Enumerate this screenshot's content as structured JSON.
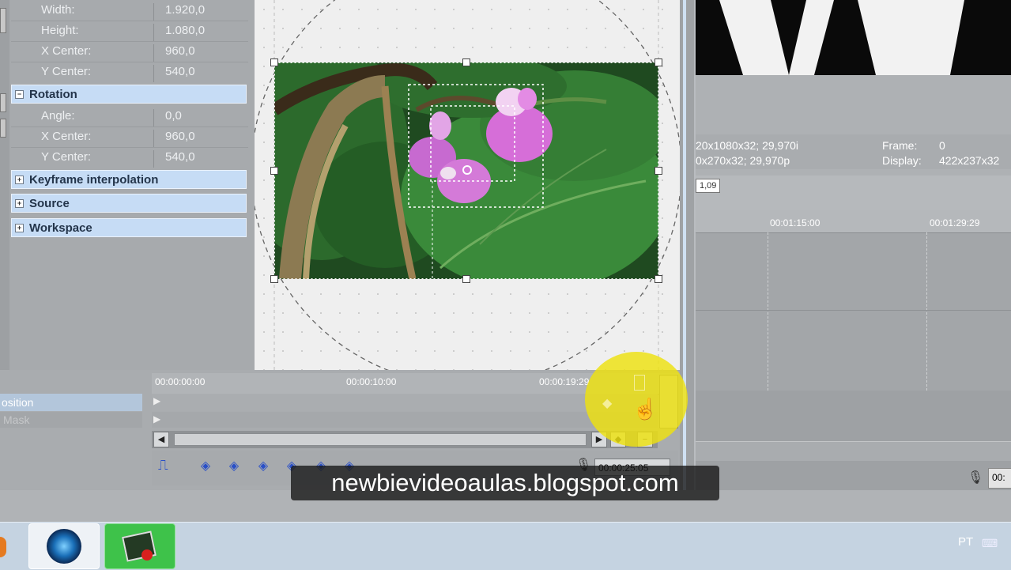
{
  "properties": {
    "rows_top": [
      {
        "label": "Width:",
        "value": "1.920,0"
      },
      {
        "label": "Height:",
        "value": "1.080,0"
      },
      {
        "label": "X Center:",
        "value": "960,0"
      },
      {
        "label": "Y Center:",
        "value": "540,0"
      }
    ],
    "rotation": {
      "title": "Rotation",
      "rows": [
        {
          "label": "Angle:",
          "value": "0,0"
        },
        {
          "label": "X Center:",
          "value": "960,0"
        },
        {
          "label": "Y Center:",
          "value": "540,0"
        }
      ]
    },
    "sections": [
      "Keyframe interpolation",
      "Source",
      "Workspace"
    ]
  },
  "preview": {
    "frame_info": "20x1080x32; 29,970i",
    "display_info": "0x270x32; 29,970p",
    "frame_label": "Frame:",
    "frame_value": "0",
    "display_label": "Display:",
    "display_value": "422x237x32",
    "badge": "1,09"
  },
  "main_timeline": {
    "ticks": [
      "00:01:15:00",
      "00:01:29:29"
    ]
  },
  "keyframes": {
    "ruler": [
      "00:00:00:00",
      "00:00:10:00",
      "00:00:19:29"
    ],
    "tracks": [
      "osition",
      "Mask"
    ],
    "cursor_time": "00:00:25:05"
  },
  "watermark": "newbievideoaulas.blogspot.com",
  "taskbar": {
    "language": "PT"
  },
  "colors": {
    "section_header": "#c6dcf5",
    "highlight": "#eee20f",
    "keyframe_diamond": "#2a50c8"
  }
}
